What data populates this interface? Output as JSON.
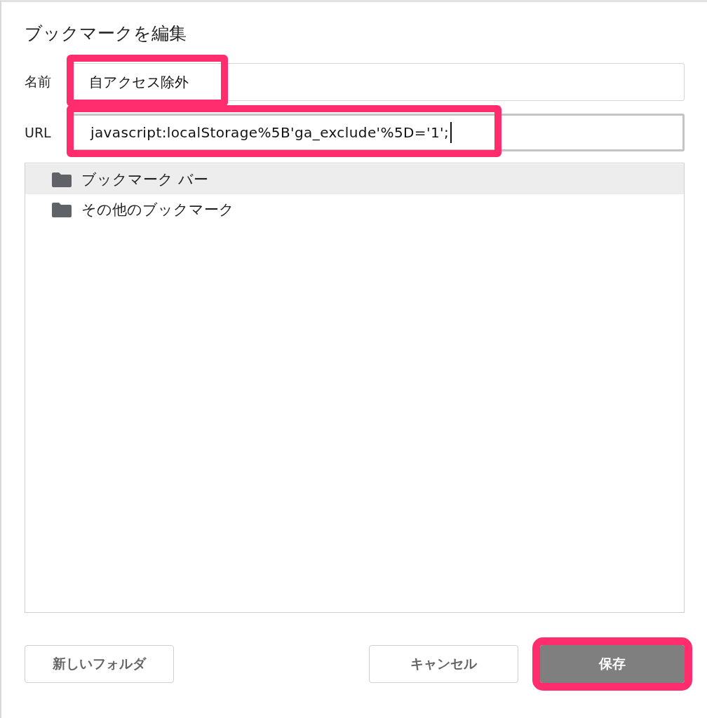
{
  "dialog": {
    "title": "ブックマークを編集"
  },
  "fields": [
    {
      "label": "名前",
      "value": "自アクセス除外",
      "focused": false,
      "highlighted": true
    },
    {
      "label": "URL",
      "value": "javascript:localStorage%5B'ga_exclude'%5D='1';",
      "focused": true,
      "highlighted": true
    }
  ],
  "folders": [
    {
      "label": "ブックマーク バー",
      "selected": true
    },
    {
      "label": "その他のブックマーク",
      "selected": false
    }
  ],
  "buttons": [
    {
      "label": "新しいフォルダ",
      "kind": "secondary",
      "highlighted": false
    },
    {
      "label": "キャンセル",
      "kind": "secondary",
      "highlighted": false
    },
    {
      "label": "保存",
      "kind": "primary",
      "highlighted": true
    }
  ]
}
